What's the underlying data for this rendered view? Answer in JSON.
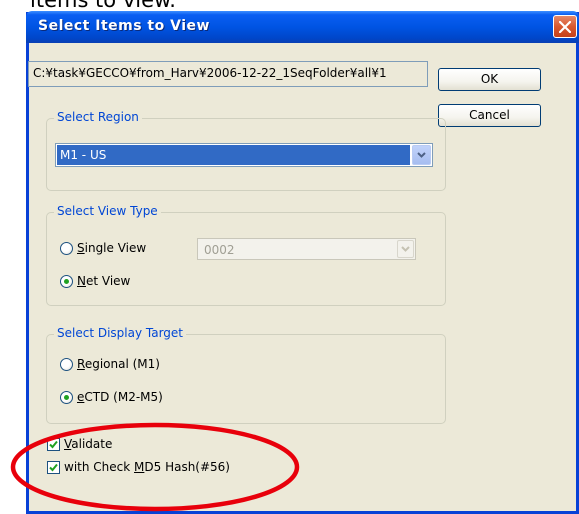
{
  "caption": "items to view.",
  "dialog": {
    "title": "Select Items to View",
    "path": "C:¥task¥GECCO¥from_Harv¥2006-12-22_1SeqFolder¥all¥1",
    "ok_label": "OK",
    "cancel_label": "Cancel"
  },
  "region": {
    "group_label": "Select Region",
    "selected": "M1 - US"
  },
  "view_type": {
    "group_label": "Select View Type",
    "single_label": "Single View",
    "net_label": "Net View",
    "view_value": "0002",
    "selected": "Net View"
  },
  "display_target": {
    "group_label": "Select Display Target",
    "regional_label": "Regional (M1)",
    "ectd_label": "eCTD (M2-M5)",
    "selected": "eCTD (M2-M5)"
  },
  "options": {
    "validate_label": "Validate",
    "validate_checked": true,
    "md5_label_pre": "with Check ",
    "md5_label_key": "M",
    "md5_label_post": "D5 Hash(#56)",
    "md5_checked": true
  },
  "colors": {
    "title_bar": "#0054e3",
    "group_label": "#0046d5",
    "highlight": "#316ac5",
    "annotation": "#e8000b"
  }
}
